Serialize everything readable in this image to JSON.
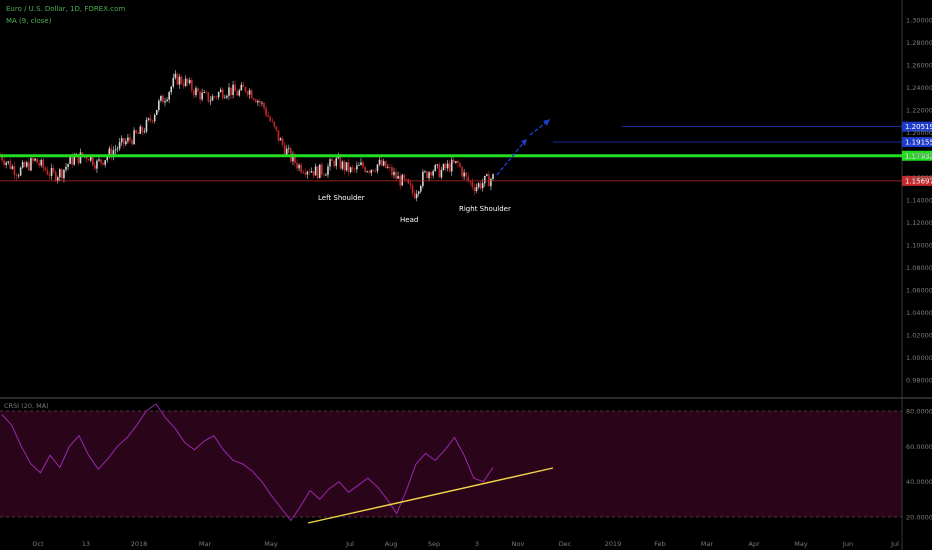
{
  "header": {
    "symbol": "Euro / U.S. Dollar, 1D, FOREX.com",
    "indicator": "MA (9, close)",
    "osc_label": "CRSI (20, MA)"
  },
  "colors": {
    "background": "#000000",
    "up_candle": "#d4d4d4",
    "down_candle": "#c62828",
    "neckline": "#22dd22",
    "support_line": "#c62828",
    "target_line": "#1e3cc8",
    "osc_line": "#9c27b0",
    "osc_band": "#2a0519",
    "trendline": "#f2d44a"
  },
  "chart_data": [
    {
      "type": "candlestick",
      "title": "Euro / U.S. Dollar, 1D, FOREX.com",
      "x_tick_labels": [
        "Oct",
        "13",
        "2018",
        "Mar",
        "May",
        "Jul",
        "Aug",
        "Sep",
        "3",
        "Nov",
        "Dec",
        "2019",
        "Feb",
        "Mar",
        "Apr",
        "May",
        "Jun",
        "Jul"
      ],
      "y_tick_labels": [
        "1.30000",
        "1.28000",
        "1.26000",
        "1.24000",
        "1.22000",
        "1.20000",
        "1.18000",
        "1.16000",
        "1.14000",
        "1.12000",
        "1.10000",
        "1.08000",
        "1.06000",
        "1.04000",
        "1.02000",
        "1.00000",
        "0.98000"
      ],
      "ylim": [
        0.97,
        1.31
      ],
      "series": [
        {
          "values": [
            1.18,
            1.172,
            1.165,
            1.17,
            1.175,
            1.168,
            1.162,
            1.165,
            1.175,
            1.178,
            1.18,
            1.172,
            1.178,
            1.185,
            1.19,
            1.195,
            1.2,
            1.21,
            1.225,
            1.235,
            1.248,
            1.245,
            1.238,
            1.232,
            1.23,
            1.236,
            1.238,
            1.235,
            1.24,
            1.232,
            1.222,
            1.205,
            1.19,
            1.178,
            1.17,
            1.168,
            1.165,
            1.167,
            1.175,
            1.17,
            1.165,
            1.17,
            1.168,
            1.172,
            1.168,
            1.16,
            1.155,
            1.145,
            1.16,
            1.168,
            1.165,
            1.17,
            1.172,
            1.158,
            1.152,
            1.156,
            1.16
          ]
        }
      ],
      "levels": [
        {
          "label": "1.20519",
          "value": 1.20519,
          "color": "#1e3cc8"
        },
        {
          "label": "1.19155",
          "value": 1.19155,
          "color": "#1e3cc8"
        },
        {
          "label": "1.17932",
          "value": 1.17932,
          "color": "#22dd22"
        },
        {
          "label": "1.15697",
          "value": 1.15697,
          "color": "#c62828"
        }
      ],
      "annotations": [
        "Left Shoulder",
        "Head",
        "Right Shoulder"
      ]
    },
    {
      "type": "line",
      "title": "CRSI (20, MA)",
      "y_tick_labels": [
        "80.0000",
        "60.0000",
        "40.0000",
        "20.0000"
      ],
      "ylim": [
        15,
        85
      ],
      "band": [
        20,
        80
      ],
      "series": [
        {
          "values": [
            78,
            72,
            60,
            50,
            45,
            55,
            48,
            60,
            66,
            55,
            47,
            53,
            60,
            65,
            72,
            80,
            84,
            76,
            70,
            62,
            58,
            63,
            66,
            58,
            52,
            50,
            46,
            40,
            32,
            25,
            18,
            26,
            35,
            30,
            36,
            40,
            34,
            38,
            42,
            37,
            30,
            22,
            35,
            50,
            56,
            52,
            58,
            65,
            55,
            42,
            40,
            48
          ]
        }
      ]
    }
  ],
  "annotations": {
    "left_shoulder": "Left Shoulder",
    "head": "Head",
    "right_shoulder": "Right Shoulder"
  }
}
